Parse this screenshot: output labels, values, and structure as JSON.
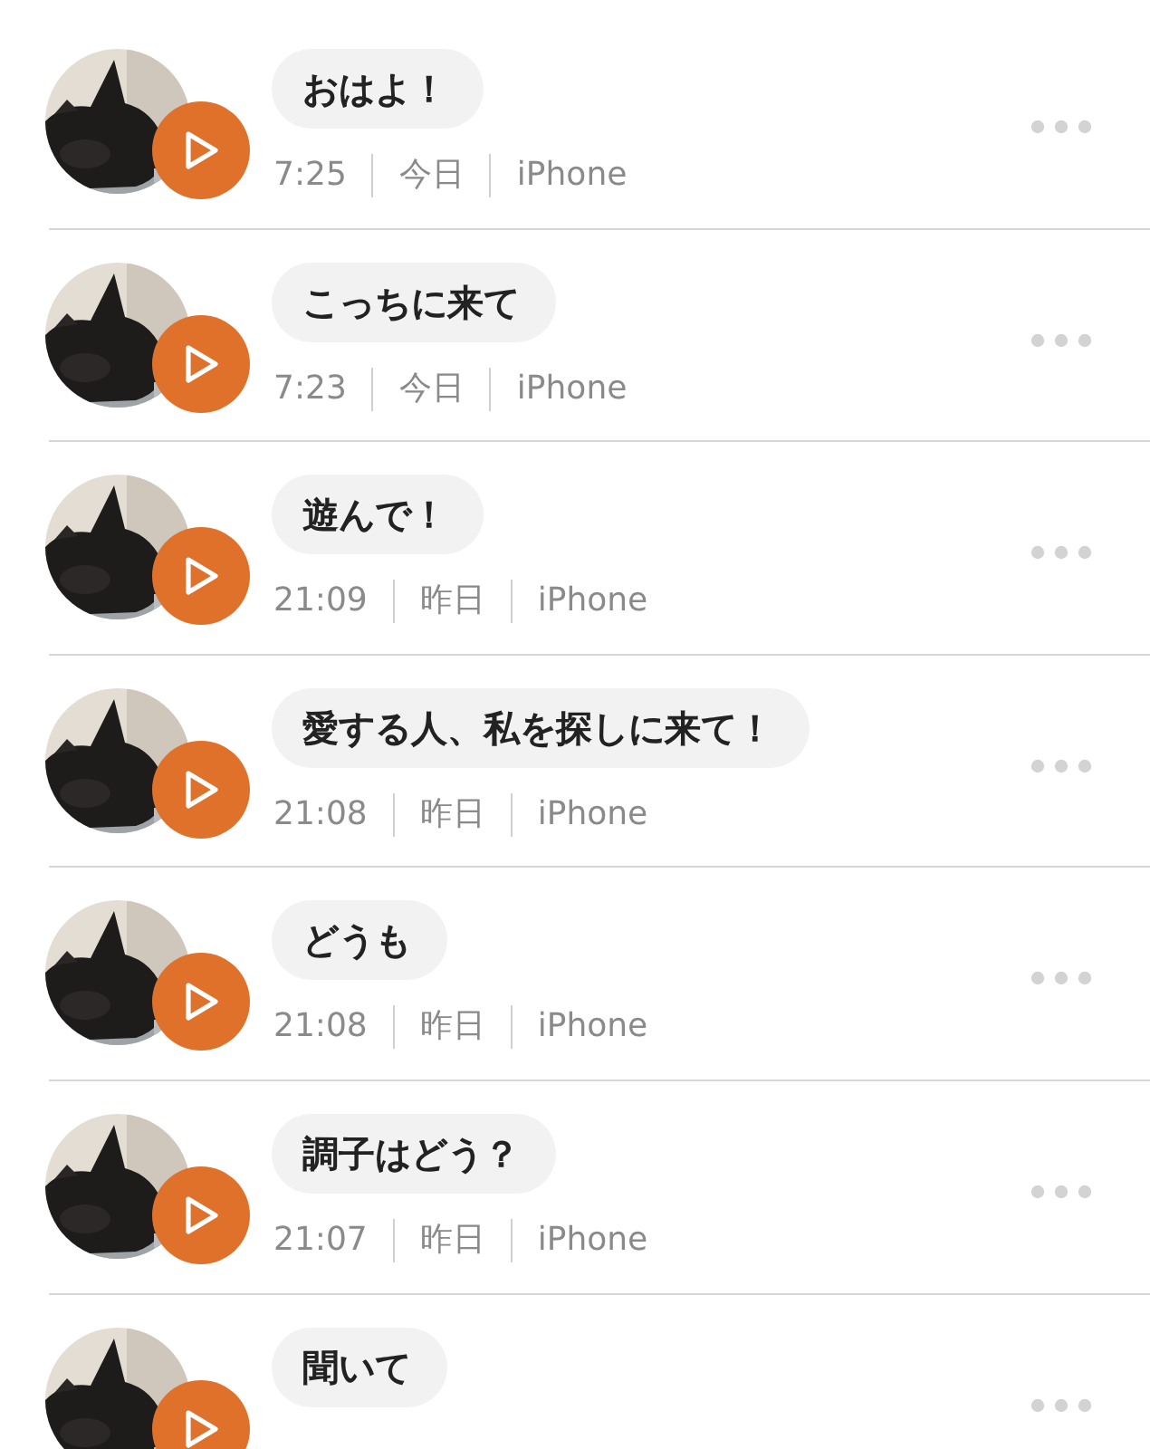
{
  "messages": [
    {
      "text": "おはよ！",
      "time": "7:25",
      "day": "今日",
      "device": "iPhone"
    },
    {
      "text": "こっちに来て",
      "time": "7:23",
      "day": "今日",
      "device": "iPhone"
    },
    {
      "text": "遊んで！",
      "time": "21:09",
      "day": "昨日",
      "device": "iPhone"
    },
    {
      "text": "愛する人、私を探しに来て！",
      "time": "21:08",
      "day": "昨日",
      "device": "iPhone"
    },
    {
      "text": "どうも",
      "time": "21:08",
      "day": "昨日",
      "device": "iPhone"
    },
    {
      "text": "調子はどう？",
      "time": "21:07",
      "day": "昨日",
      "device": "iPhone"
    },
    {
      "text": "聞いて"
    }
  ]
}
